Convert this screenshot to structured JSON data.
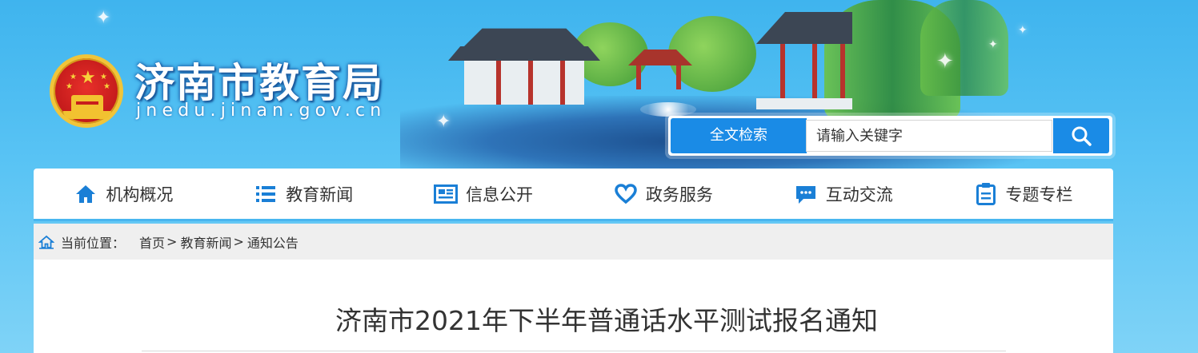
{
  "header": {
    "site_title": "济南市教育局",
    "site_domain": "jnedu.jinan.gov.cn",
    "emblem": "national-emblem",
    "colors": {
      "banner_bg": "#3fb4ee",
      "accent": "#1a8be6",
      "title_text": "#ffffff"
    }
  },
  "search": {
    "label": "全文检索",
    "placeholder": "请输入关键字",
    "button_icon": "search-icon"
  },
  "nav": {
    "items": [
      {
        "label": "机构概况",
        "icon": "home-icon"
      },
      {
        "label": "教育新闻",
        "icon": "list-icon"
      },
      {
        "label": "信息公开",
        "icon": "newspaper-icon"
      },
      {
        "label": "政务服务",
        "icon": "heart-icon"
      },
      {
        "label": "互动交流",
        "icon": "chat-bubble-icon"
      },
      {
        "label": "专题专栏",
        "icon": "clipboard-icon"
      }
    ],
    "colors": {
      "icon": "#1a7fd6",
      "underline": "#49b6ef"
    }
  },
  "breadcrumb": {
    "prefix": "当前位置：",
    "items": [
      "首页",
      "教育新闻",
      "通知公告"
    ],
    "separator": ">",
    "icon": "location-home-icon"
  },
  "article": {
    "title": "济南市2021年下半年普通话水平测试报名通知"
  }
}
